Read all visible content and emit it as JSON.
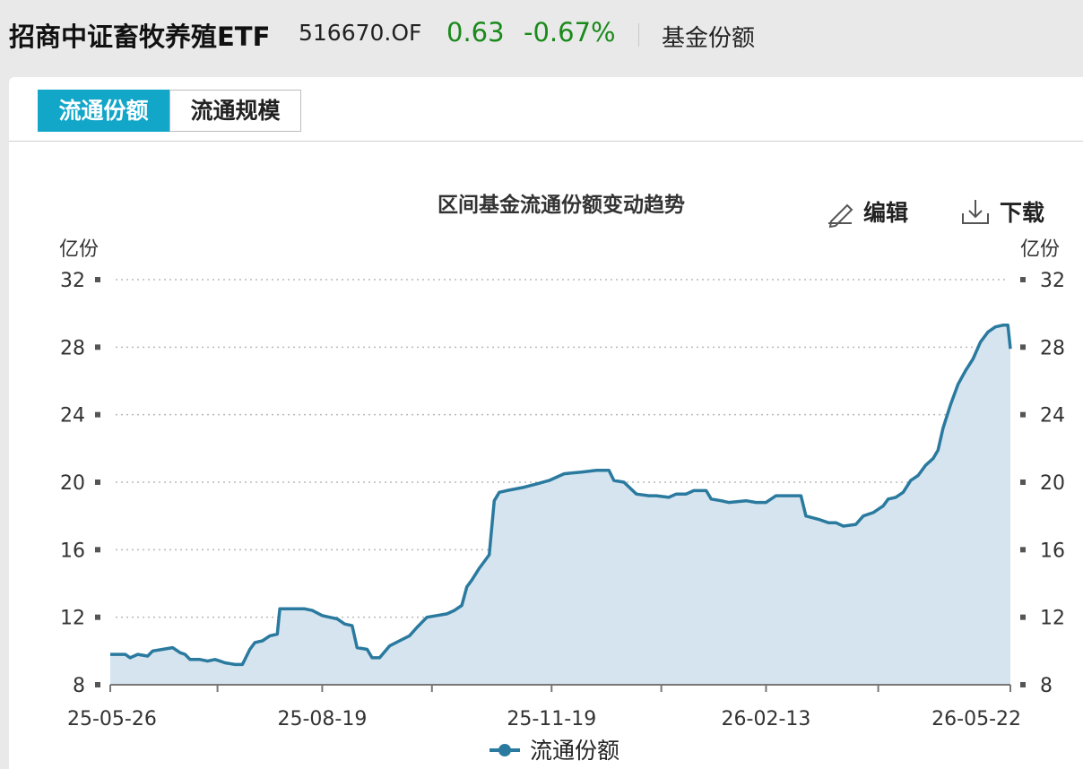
{
  "header": {
    "fund_name": "招商中证畜牧养殖ETF",
    "fund_code": "516670.OF",
    "price": "0.63",
    "change_pct": "-0.67%",
    "tab_label": "基金份额"
  },
  "tabs": [
    {
      "label": "流通份额",
      "active": true
    },
    {
      "label": "流通规模",
      "active": false
    }
  ],
  "toolbar": {
    "edit_label": "编辑",
    "download_label": "下载"
  },
  "colors": {
    "accent": "#12a6c9",
    "positive_change": "#1a8a1a",
    "series_line": "#2a7a9f",
    "series_fill": "#d6e4ef"
  },
  "chart_data": {
    "type": "area",
    "title": "区间基金流通份额变动趋势",
    "ylabel_left": "亿份",
    "ylabel_right": "亿份",
    "ylim": [
      8,
      32
    ],
    "yticks": [
      8,
      12,
      16,
      20,
      24,
      28,
      32
    ],
    "xlim": [
      "2025-05-26",
      "2026-05-22"
    ],
    "xtick_labels": [
      {
        "date": "2025-05-26",
        "label": "25-05-26"
      },
      {
        "date": "2025-08-19",
        "label": "25-08-19"
      },
      {
        "date": "2025-11-19",
        "label": "25-11-19"
      },
      {
        "date": "2026-02-13",
        "label": "26-02-13"
      },
      {
        "date": "2026-05-22",
        "label": "26-05-22"
      }
    ],
    "xtick_marks": [
      "2025-05-26",
      "2025-07-08",
      "2025-08-19",
      "2025-10-02",
      "2025-11-19",
      "2026-01-02",
      "2026-02-13",
      "2026-03-30",
      "2026-05-22"
    ],
    "grid": true,
    "legend": "bottom-center",
    "series": [
      {
        "name": "流通份额",
        "points": [
          [
            "2025-05-26",
            9.8
          ],
          [
            "2025-06-01",
            9.8
          ],
          [
            "2025-06-03",
            9.6
          ],
          [
            "2025-06-06",
            9.8
          ],
          [
            "2025-06-10",
            9.7
          ],
          [
            "2025-06-12",
            10.0
          ],
          [
            "2025-06-16",
            10.1
          ],
          [
            "2025-06-20",
            10.2
          ],
          [
            "2025-06-23",
            9.9
          ],
          [
            "2025-06-25",
            9.8
          ],
          [
            "2025-06-27",
            9.5
          ],
          [
            "2025-07-01",
            9.5
          ],
          [
            "2025-07-04",
            9.4
          ],
          [
            "2025-07-07",
            9.5
          ],
          [
            "2025-07-09",
            9.4
          ],
          [
            "2025-07-11",
            9.3
          ],
          [
            "2025-07-15",
            9.2
          ],
          [
            "2025-07-18",
            9.2
          ],
          [
            "2025-07-21",
            10.1
          ],
          [
            "2025-07-23",
            10.5
          ],
          [
            "2025-07-26",
            10.6
          ],
          [
            "2025-07-29",
            10.9
          ],
          [
            "2025-08-01",
            11.0
          ],
          [
            "2025-08-02",
            12.5
          ],
          [
            "2025-08-06",
            12.5
          ],
          [
            "2025-08-12",
            12.5
          ],
          [
            "2025-08-15",
            12.4
          ],
          [
            "2025-08-19",
            12.1
          ],
          [
            "2025-08-22",
            12.0
          ],
          [
            "2025-08-25",
            11.9
          ],
          [
            "2025-08-28",
            11.6
          ],
          [
            "2025-08-31",
            11.5
          ],
          [
            "2025-09-02",
            10.2
          ],
          [
            "2025-09-06",
            10.1
          ],
          [
            "2025-09-08",
            9.6
          ],
          [
            "2025-09-11",
            9.6
          ],
          [
            "2025-09-15",
            10.3
          ],
          [
            "2025-09-19",
            10.6
          ],
          [
            "2025-09-23",
            10.9
          ],
          [
            "2025-09-26",
            11.4
          ],
          [
            "2025-09-30",
            12.0
          ],
          [
            "2025-10-04",
            12.1
          ],
          [
            "2025-10-08",
            12.2
          ],
          [
            "2025-10-11",
            12.4
          ],
          [
            "2025-10-14",
            12.7
          ],
          [
            "2025-10-16",
            13.8
          ],
          [
            "2025-10-18",
            14.2
          ],
          [
            "2025-10-21",
            14.9
          ],
          [
            "2025-10-23",
            15.3
          ],
          [
            "2025-10-25",
            15.7
          ],
          [
            "2025-10-27",
            18.9
          ],
          [
            "2025-10-29",
            19.4
          ],
          [
            "2025-11-01",
            19.5
          ],
          [
            "2025-11-08",
            19.7
          ],
          [
            "2025-11-13",
            19.9
          ],
          [
            "2025-11-18",
            20.1
          ],
          [
            "2025-11-24",
            20.5
          ],
          [
            "2025-12-01",
            20.6
          ],
          [
            "2025-12-07",
            20.7
          ],
          [
            "2025-12-12",
            20.7
          ],
          [
            "2025-12-14",
            20.1
          ],
          [
            "2025-12-18",
            20.0
          ],
          [
            "2025-12-23",
            19.3
          ],
          [
            "2025-12-28",
            19.2
          ],
          [
            "2025-12-31",
            19.2
          ],
          [
            "2026-01-05",
            19.1
          ],
          [
            "2026-01-08",
            19.3
          ],
          [
            "2026-01-12",
            19.3
          ],
          [
            "2026-01-15",
            19.5
          ],
          [
            "2026-01-20",
            19.5
          ],
          [
            "2026-01-22",
            19.0
          ],
          [
            "2026-01-26",
            18.9
          ],
          [
            "2026-01-29",
            18.8
          ],
          [
            "2026-02-05",
            18.9
          ],
          [
            "2026-02-09",
            18.8
          ],
          [
            "2026-02-13",
            18.8
          ],
          [
            "2026-02-17",
            19.2
          ],
          [
            "2026-02-22",
            19.2
          ],
          [
            "2026-02-27",
            19.2
          ],
          [
            "2026-03-01",
            18.0
          ],
          [
            "2026-03-06",
            17.8
          ],
          [
            "2026-03-10",
            17.6
          ],
          [
            "2026-03-13",
            17.6
          ],
          [
            "2026-03-16",
            17.4
          ],
          [
            "2026-03-21",
            17.5
          ],
          [
            "2026-03-24",
            18.0
          ],
          [
            "2026-03-28",
            18.2
          ],
          [
            "2026-04-01",
            18.6
          ],
          [
            "2026-04-03",
            19.0
          ],
          [
            "2026-04-06",
            19.1
          ],
          [
            "2026-04-09",
            19.4
          ],
          [
            "2026-04-12",
            20.1
          ],
          [
            "2026-04-15",
            20.4
          ],
          [
            "2026-04-18",
            21.0
          ],
          [
            "2026-04-21",
            21.4
          ],
          [
            "2026-04-23",
            21.9
          ],
          [
            "2026-04-25",
            23.2
          ],
          [
            "2026-04-28",
            24.6
          ],
          [
            "2026-05-01",
            25.8
          ],
          [
            "2026-05-04",
            26.6
          ],
          [
            "2026-05-07",
            27.3
          ],
          [
            "2026-05-10",
            28.3
          ],
          [
            "2026-05-13",
            28.9
          ],
          [
            "2026-05-16",
            29.2
          ],
          [
            "2026-05-19",
            29.3
          ],
          [
            "2026-05-21",
            29.3
          ],
          [
            "2026-05-22",
            27.9
          ]
        ]
      }
    ]
  }
}
